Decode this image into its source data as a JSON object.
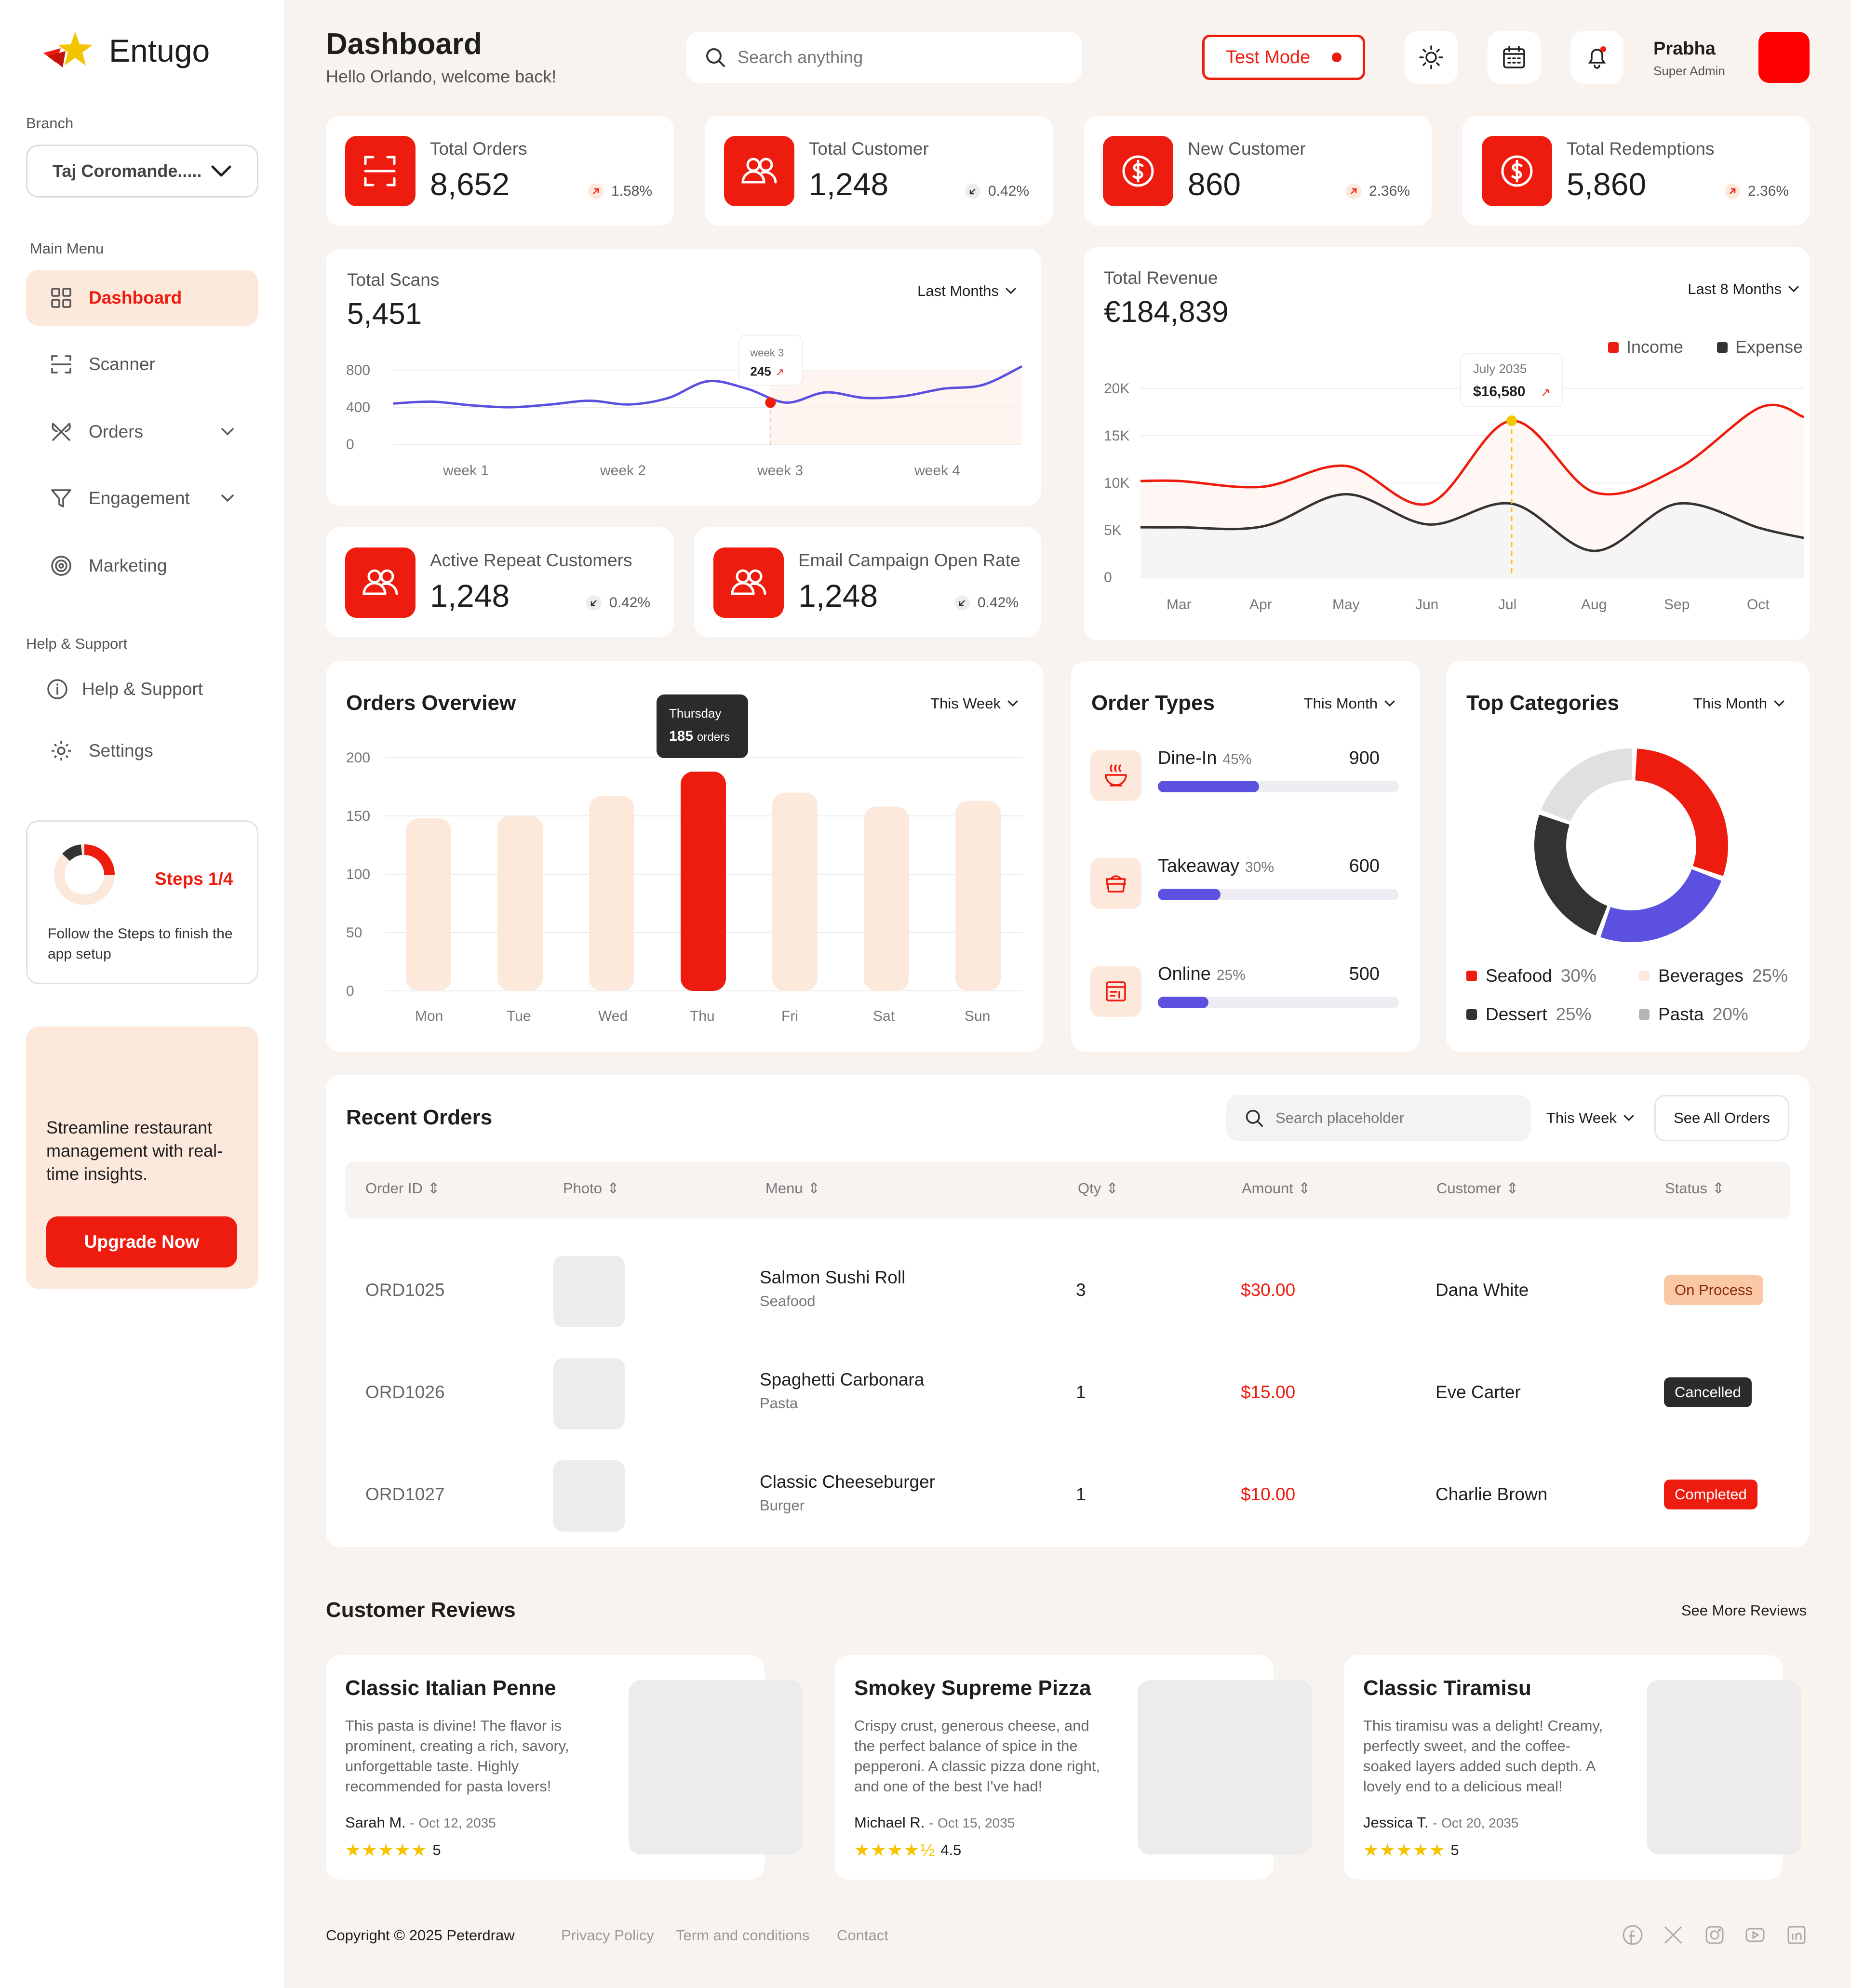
{
  "brand": {
    "name": "Entugo",
    "accent": "#ee1c0e",
    "accent_light": "#fde8dc",
    "purple": "#5b50e0"
  },
  "sidebar": {
    "branch_label": "Branch",
    "branch_value": "Taj Coromande.....",
    "main_menu_label": "Main Menu",
    "items": [
      {
        "label": "Dashboard",
        "icon": "grid-icon",
        "active": true
      },
      {
        "label": "Scanner",
        "icon": "scan-icon"
      },
      {
        "label": "Orders",
        "icon": "utensils-icon",
        "expandable": true
      },
      {
        "label": "Engagement",
        "icon": "funnel-icon",
        "expandable": true
      },
      {
        "label": "Marketing",
        "icon": "target-icon"
      }
    ],
    "help_label": "Help & Support",
    "help_items": [
      {
        "label": "Help & Support",
        "icon": "info-icon"
      },
      {
        "label": "Settings",
        "icon": "gear-icon"
      }
    ],
    "steps": {
      "title": "Steps 1/4",
      "text": "Follow the Steps to finish the  app setup"
    },
    "promo": {
      "text": "Streamline restaurant management with real-time insights.",
      "button": "Upgrade Now"
    }
  },
  "header": {
    "title": "Dashboard",
    "subtitle": "Hello Orlando, welcome back!",
    "search_placeholder": "Search anything",
    "test_mode": "Test Mode",
    "user_name": "Prabha",
    "user_role": "Super Admin"
  },
  "stats": [
    {
      "label": "Total Orders",
      "value": "8,652",
      "change": "1.58%",
      "trend": "up",
      "icon": "scan-icon"
    },
    {
      "label": "Total Customer",
      "value": "1,248",
      "change": "0.42%",
      "trend": "down",
      "icon": "users-icon"
    },
    {
      "label": "New Customer",
      "value": "860",
      "change": "2.36%",
      "trend": "up",
      "icon": "dollar-icon"
    },
    {
      "label": "Total Redemptions",
      "value": "5,860",
      "change": "2.36%",
      "trend": "up",
      "icon": "dollar-icon"
    }
  ],
  "stats2": [
    {
      "label": "Active Repeat Customers",
      "value": "1,248",
      "change": "0.42%",
      "trend": "down",
      "icon": "users-icon"
    },
    {
      "label": "Email Campaign Open Rate",
      "value": "1,248",
      "change": "0.42%",
      "trend": "down",
      "icon": "users-icon"
    }
  ],
  "scans": {
    "label": "Total Scans",
    "value": "5,451",
    "period": "Last Months",
    "tooltip_label": "week 3",
    "tooltip_value": "245"
  },
  "revenue": {
    "label": "Total Revenue",
    "value": "€184,839",
    "period": "Last 8 Months",
    "tooltip_label": "July 2035",
    "tooltip_value": "$16,580"
  },
  "orders_overview": {
    "title": "Orders Overview",
    "period": "This Week",
    "tooltip_day": "Thursday",
    "tooltip_value": "185",
    "tooltip_unit": "orders"
  },
  "order_types": {
    "title": "Order Types",
    "period": "This Month",
    "items": [
      {
        "name": "Dine-In",
        "pct": "45%",
        "value": "900",
        "fraction": 0.42,
        "icon": "bowl-icon"
      },
      {
        "name": "Takeaway",
        "pct": "30%",
        "value": "600",
        "fraction": 0.26,
        "icon": "takeaway-box-icon"
      },
      {
        "name": "Online",
        "pct": "25%",
        "value": "500",
        "fraction": 0.21,
        "icon": "online-order-icon"
      }
    ]
  },
  "top_categories": {
    "title": "Top Categories",
    "period": "This Month",
    "items": [
      {
        "name": "Seafood",
        "pct": "30%",
        "color": "#ee1c0e"
      },
      {
        "name": "Beverages",
        "pct": "25%",
        "color": "#fde8dc"
      },
      {
        "name": "Dessert",
        "pct": "25%",
        "color": "#333333"
      },
      {
        "name": "Pasta",
        "pct": "20%",
        "color": "#b5b5b5"
      }
    ]
  },
  "chart_data": [
    {
      "type": "line",
      "title": "Total Scans",
      "categories": [
        "week 1",
        "week 2",
        "week 3",
        "week 4"
      ],
      "x": [
        0,
        0.5,
        1,
        1.5,
        2,
        2.5,
        3,
        3.5,
        4,
        4.5,
        5,
        5.5,
        6,
        6.5,
        7,
        7.5,
        8
      ],
      "series": [
        {
          "values": [
            440,
            460,
            420,
            400,
            430,
            470,
            430,
            500,
            680,
            600,
            450,
            560,
            500,
            520,
            600,
            640,
            840
          ]
        }
      ],
      "yticks": [
        "0",
        "400",
        "800"
      ],
      "ylim": [
        0,
        800
      ],
      "highlight": {
        "x": "week 3",
        "value": 245
      }
    },
    {
      "type": "line",
      "title": "Total Revenue",
      "categories": [
        "Mar",
        "Apr",
        "May",
        "Jun",
        "Jul",
        "Aug",
        "Sep",
        "Oct"
      ],
      "yticks": [
        "0",
        "5K",
        "10K",
        "15K",
        "20K"
      ],
      "ylim": [
        0,
        20000
      ],
      "series": [
        {
          "name": "Income",
          "color": "#ee1c0e",
          "values": [
            10200,
            9600,
            11800,
            7800,
            16580,
            9000,
            11500,
            18000
          ]
        },
        {
          "name": "Expense",
          "color": "#333333",
          "values": [
            5300,
            5400,
            8800,
            5600,
            7800,
            2800,
            7800,
            5200
          ]
        }
      ],
      "highlight": {
        "x": "Jul",
        "label": "July 2035",
        "value": 16580
      }
    },
    {
      "type": "bar",
      "title": "Orders Overview",
      "categories": [
        "Mon",
        "Tue",
        "Wed",
        "Thu",
        "Fri",
        "Sat",
        "Sun"
      ],
      "values": [
        148,
        150,
        167,
        188,
        170,
        158,
        163
      ],
      "yticks": [
        "0",
        "50",
        "100",
        "150",
        "200"
      ],
      "ylim": [
        0,
        200
      ],
      "highlight": "Thu"
    },
    {
      "type": "pie",
      "title": "Top Categories",
      "categories": [
        "Seafood",
        "Beverages",
        "Dessert",
        "Pasta"
      ],
      "values": [
        30,
        25,
        25,
        20
      ],
      "colors": [
        "#ee1c0e",
        "#5b50e0",
        "#333333",
        "#e0e0e0"
      ]
    }
  ],
  "recent_orders": {
    "title": "Recent Orders",
    "search_placeholder": "Search placeholder",
    "period": "This Week",
    "see_all": "See All Orders",
    "columns": [
      "Order ID",
      "Photo",
      "Menu",
      "Qty",
      "Amount",
      "Customer",
      "Status"
    ],
    "rows": [
      {
        "id": "ORD1025",
        "menu": "Salmon Sushi Roll",
        "category": "Seafood",
        "qty": "3",
        "amount": "$30.00",
        "customer": "Dana White",
        "status": "On Process"
      },
      {
        "id": "ORD1026",
        "menu": "Spaghetti Carbonara",
        "category": "Pasta",
        "qty": "1",
        "amount": "$15.00",
        "customer": "Eve Carter",
        "status": "Cancelled"
      },
      {
        "id": "ORD1027",
        "menu": "Classic Cheeseburger",
        "category": "Burger",
        "qty": "1",
        "amount": "$10.00",
        "customer": "Charlie Brown",
        "status": "Completed"
      }
    ]
  },
  "reviews": {
    "title": "Customer Reviews",
    "see_more": "See More Reviews",
    "items": [
      {
        "title": "Classic Italian Penne",
        "text": "This pasta is divine! The flavor is prominent, creating a rich, savory, unforgettable taste. Highly recommended for pasta lovers!",
        "author": "Sarah M.",
        "date": "Oct 12, 2035",
        "stars": "★★★★★",
        "rating": "5"
      },
      {
        "title": "Smokey Supreme Pizza",
        "text": "Crispy crust, generous cheese, and the perfect balance of spice in the pepperoni. A classic pizza done right, and one of the best I've had!",
        "author": "Michael R.",
        "date": "Oct 15, 2035",
        "stars": "★★★★½",
        "rating": "4.5"
      },
      {
        "title": "Classic Tiramisu",
        "text": "This tiramisu was a delight! Creamy, perfectly sweet, and the coffee-soaked layers added such depth. A lovely end to a delicious meal!",
        "author": "Jessica T.",
        "date": "Oct 20, 2035",
        "stars": "★★★★★",
        "rating": "5"
      }
    ]
  },
  "footer": {
    "copyright": "Copyright © 2025 Peterdraw",
    "links": [
      "Privacy Policy",
      "Term and conditions",
      "Contact"
    ],
    "social": [
      "facebook-icon",
      "x-icon",
      "instagram-icon",
      "youtube-icon",
      "linkedin-icon"
    ]
  }
}
